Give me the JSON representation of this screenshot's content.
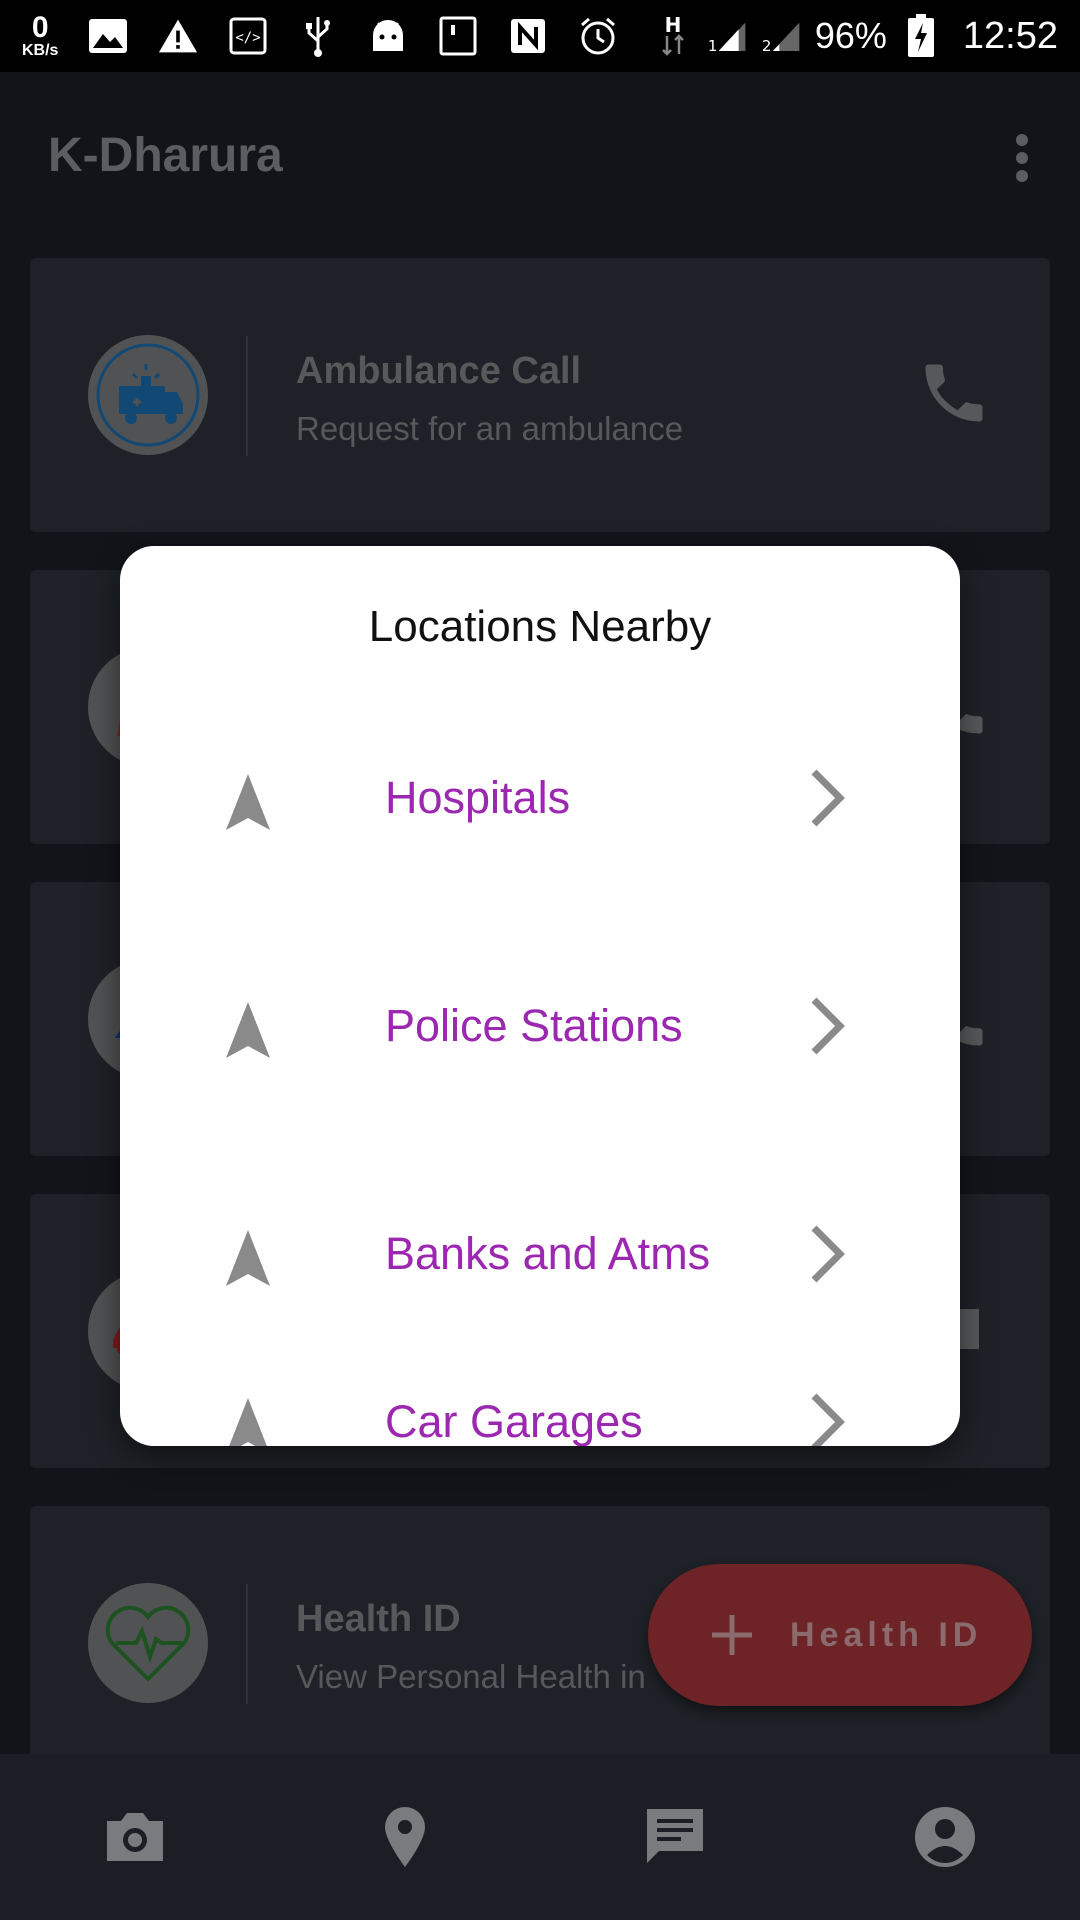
{
  "status_bar": {
    "speed_value": "0",
    "speed_unit": "KB/s",
    "battery": "96%",
    "time": "12:52",
    "icons": [
      "image-icon",
      "warning-icon",
      "code-icon",
      "usb-icon",
      "android-icon",
      "sim-icon",
      "nfc-icon",
      "alarm-icon",
      "hspa-icon",
      "signal-1-icon",
      "signal-2-icon",
      "battery-charging-icon"
    ]
  },
  "app_bar": {
    "title": "K-Dharura",
    "menu_icon": "more-vert-icon"
  },
  "cards": [
    {
      "title": "Ambulance Call",
      "subtitle": "Request for an ambulance",
      "icon": "ambulance-icon",
      "action_icon": "phone-icon"
    },
    {
      "title": "",
      "subtitle": "",
      "icon": "firefighter-icon",
      "action_icon": "phone-icon"
    },
    {
      "title": "",
      "subtitle": "",
      "icon": "police-icon",
      "action_icon": "phone-icon"
    },
    {
      "title": "",
      "subtitle": "",
      "icon": "car-icon",
      "action_icon": "message-icon"
    },
    {
      "title": "Health ID",
      "subtitle": "View Personal Health in",
      "icon": "heartbeat-icon",
      "action_icon": ""
    }
  ],
  "fab": {
    "label": "Health ID",
    "icon": "plus-icon"
  },
  "dialog": {
    "title": "Locations Nearby",
    "items": [
      {
        "label": "Hospitals"
      },
      {
        "label": "Police Stations"
      },
      {
        "label": "Banks and Atms"
      },
      {
        "label": "Car Garages"
      }
    ]
  },
  "bottom_nav": [
    {
      "name": "camera-icon"
    },
    {
      "name": "location-pin-icon"
    },
    {
      "name": "chat-icon"
    },
    {
      "name": "account-icon"
    }
  ],
  "colors": {
    "accent_purple": "#9c27b0",
    "fab_red": "#c62828",
    "app_bg": "#1d2029"
  }
}
